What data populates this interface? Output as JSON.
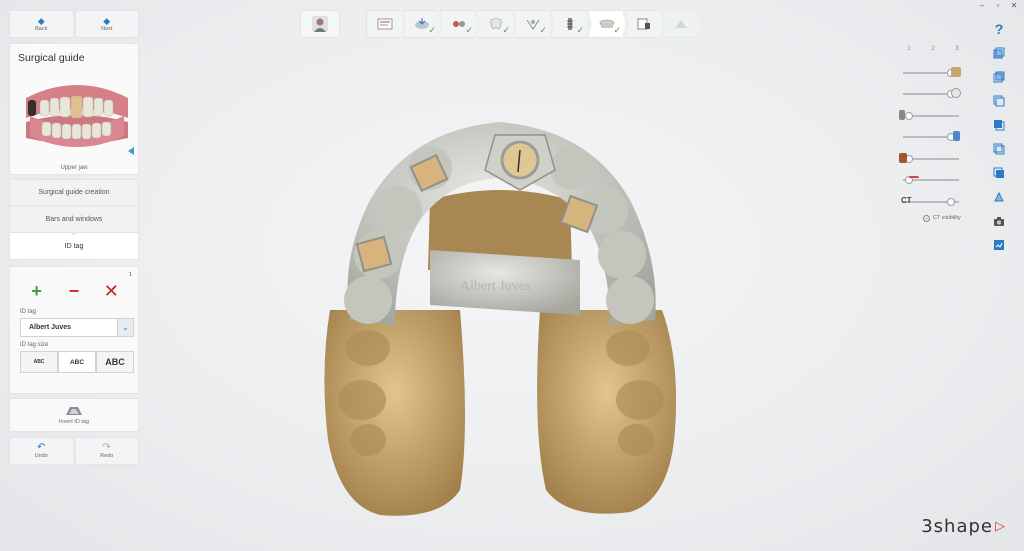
{
  "window": {
    "minimize": "–",
    "maximize": "▫",
    "close": "✕"
  },
  "nav": {
    "back_label": "Back",
    "next_label": "Next"
  },
  "guide_panel": {
    "title": "Surgical guide",
    "jaw_caption": "Upper jaw"
  },
  "steps": [
    {
      "label": "Surgical guide creation",
      "active": false
    },
    {
      "label": "Bars and windows",
      "active": false
    },
    {
      "label": "ID tag",
      "active": true
    }
  ],
  "tools": {
    "count": "1",
    "id_tag_label": "ID tag",
    "id_tag_value": "Albert Juves",
    "size_label": "ID tag size",
    "sizes": [
      "ABC",
      "ABC",
      "ABC"
    ],
    "invert_label": "Invert ID tag"
  },
  "history": {
    "undo_label": "Undo",
    "redo_label": "Redo"
  },
  "visibility": {
    "tabs": [
      "1",
      "2",
      "3"
    ],
    "ct_label": "CT",
    "ct_visibility_label": "CT visibility",
    "slider_levels": [
      0.85,
      0.85,
      0.1,
      0.85,
      0.1,
      0.1,
      0.85
    ]
  },
  "tag_text_on_model": "Albert Juves",
  "logo_text": "3shape",
  "colors": {
    "accent": "#2c79c6",
    "add": "#3e9b3a",
    "remove": "#d2302a",
    "check": "#41a13b",
    "guide": "#c9cbc3",
    "scan": "#c8a56c"
  }
}
